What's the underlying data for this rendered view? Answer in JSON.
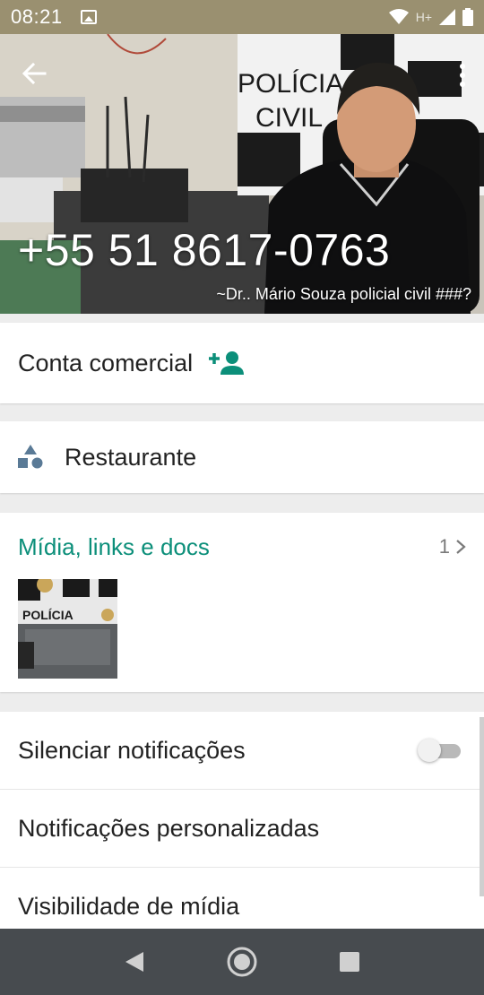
{
  "status_bar": {
    "time": "08:21",
    "network": "H+",
    "icons": [
      "image-icon",
      "wifi-icon",
      "signal-icon",
      "battery-icon"
    ]
  },
  "header": {
    "title": "+55 51 8617-0763",
    "push_name": "~Dr.. Mário Souza policial civil ###?",
    "background_sign_line1": "POLÍCIA",
    "background_sign_line2": "CIVIL",
    "icons": [
      "back-arrow-icon",
      "more-vert-icon"
    ]
  },
  "business": {
    "label": "Conta comercial",
    "icon": "add-contact-icon",
    "accent_color": "#0c8f7a"
  },
  "category": {
    "label": "Restaurante",
    "icon": "category-shapes-icon"
  },
  "media": {
    "title": "Mídia, links e docs",
    "count": "1",
    "thumbnail_text": "POLÍCIA",
    "accent_color": "#0c8f7a"
  },
  "settings": {
    "mute_label": "Silenciar notificações",
    "mute_enabled": false,
    "custom_notifications_label": "Notificações personalizadas",
    "media_visibility_label": "Visibilidade de mídia"
  },
  "nav_bar": {
    "icons": [
      "back-triangle-icon",
      "home-circle-icon",
      "recents-square-icon"
    ]
  }
}
